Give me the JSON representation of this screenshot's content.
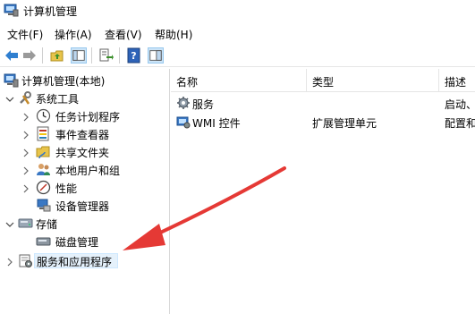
{
  "window": {
    "title": "计算机管理"
  },
  "menu": [
    {
      "label": "文件(F)"
    },
    {
      "label": "操作(A)"
    },
    {
      "label": "查看(V)"
    },
    {
      "label": "帮助(H)"
    }
  ],
  "toolbar": {
    "buttons": [
      {
        "icon": "back-arrow-icon"
      },
      {
        "icon": "forward-arrow-icon"
      },
      {
        "icon": "up-folder-icon"
      },
      {
        "icon": "show-hide-tree-icon"
      },
      {
        "icon": "export-list-icon"
      },
      {
        "icon": "help-icon"
      },
      {
        "icon": "properties-pane-icon"
      }
    ]
  },
  "tree": {
    "root": "计算机管理(本地)",
    "system_tools": "系统工具",
    "task_scheduler": "任务计划程序",
    "event_viewer": "事件查看器",
    "shared_folders": "共享文件夹",
    "local_users": "本地用户和组",
    "performance": "性能",
    "device_manager": "设备管理器",
    "storage": "存储",
    "disk_management": "磁盘管理",
    "services_apps": "服务和应用程序"
  },
  "list": {
    "columns": [
      {
        "label": "名称"
      },
      {
        "label": "类型"
      },
      {
        "label": "描述"
      }
    ],
    "rows": [
      {
        "name": "服务",
        "type": "",
        "desc": "启动、"
      },
      {
        "name": "WMI 控件",
        "type": "扩展管理单元",
        "desc": "配置和"
      }
    ]
  },
  "colors": {
    "arrow": "#e53935",
    "selection": "#e5f1fb"
  }
}
